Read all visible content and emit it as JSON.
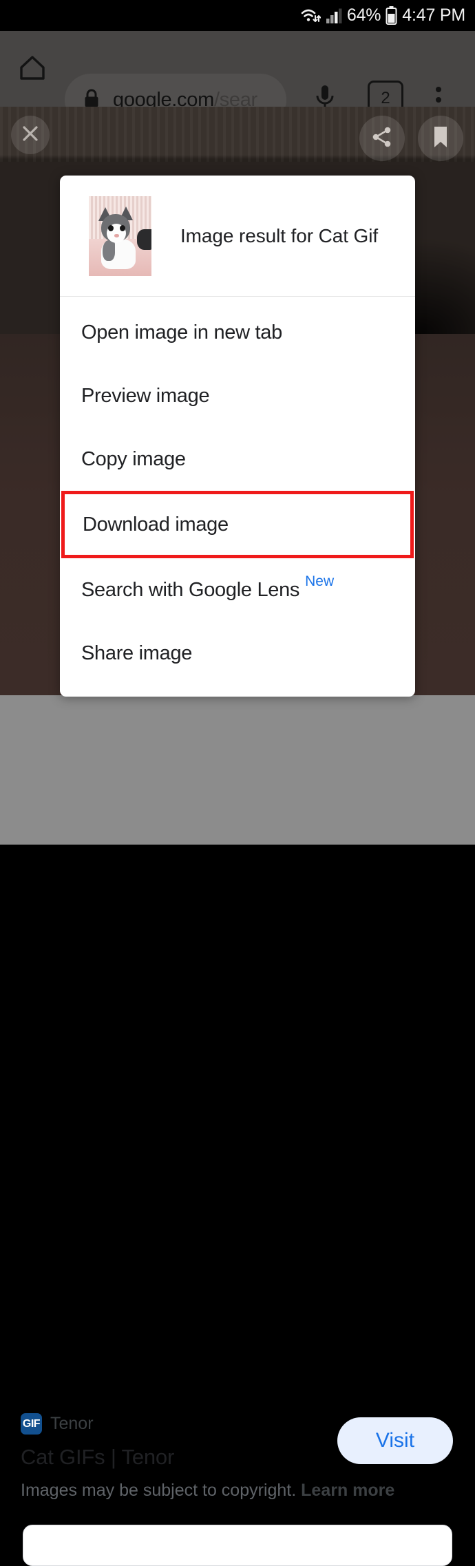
{
  "status_bar": {
    "wifi_icon": "wifi-transfer-icon",
    "signal_icon": "cellular-signal-icon",
    "battery_percent": "64%",
    "battery_icon": "battery-icon",
    "time": "4:47 PM"
  },
  "browser": {
    "home_icon": "home-icon",
    "lock_icon": "lock-icon",
    "url_domain": "google.com",
    "url_path": "/sear",
    "mic_icon": "microphone-icon",
    "tab_count": "2",
    "overflow_icon": "three-dots-menu-icon"
  },
  "viewer": {
    "close_icon": "close-x-icon",
    "share_icon": "share-icon",
    "bookmark_icon": "bookmark-icon"
  },
  "dialog": {
    "header_title": "Image result for Cat Gif",
    "thumbnail_name": "cat-thumbnail",
    "items": [
      {
        "label": "Open image in new tab",
        "name": "open-image-in-new-tab"
      },
      {
        "label": "Preview image",
        "name": "preview-image"
      },
      {
        "label": "Copy image",
        "name": "copy-image"
      },
      {
        "label": "Download image",
        "name": "download-image",
        "highlighted": true
      },
      {
        "label": "Search with Google Lens",
        "name": "search-with-google-lens",
        "badge": "New"
      },
      {
        "label": "Share image",
        "name": "share-image"
      }
    ],
    "highlight_color": "#ef1a1a",
    "badge_color": "#1a73e8"
  },
  "info_panel": {
    "source_favicon_text": "GIF",
    "source_name": "Tenor",
    "title": "Cat GIFs | Tenor",
    "copyright_text": "Images may be subject to copyright.",
    "learn_more": "Learn more",
    "visit_label": "Visit"
  }
}
